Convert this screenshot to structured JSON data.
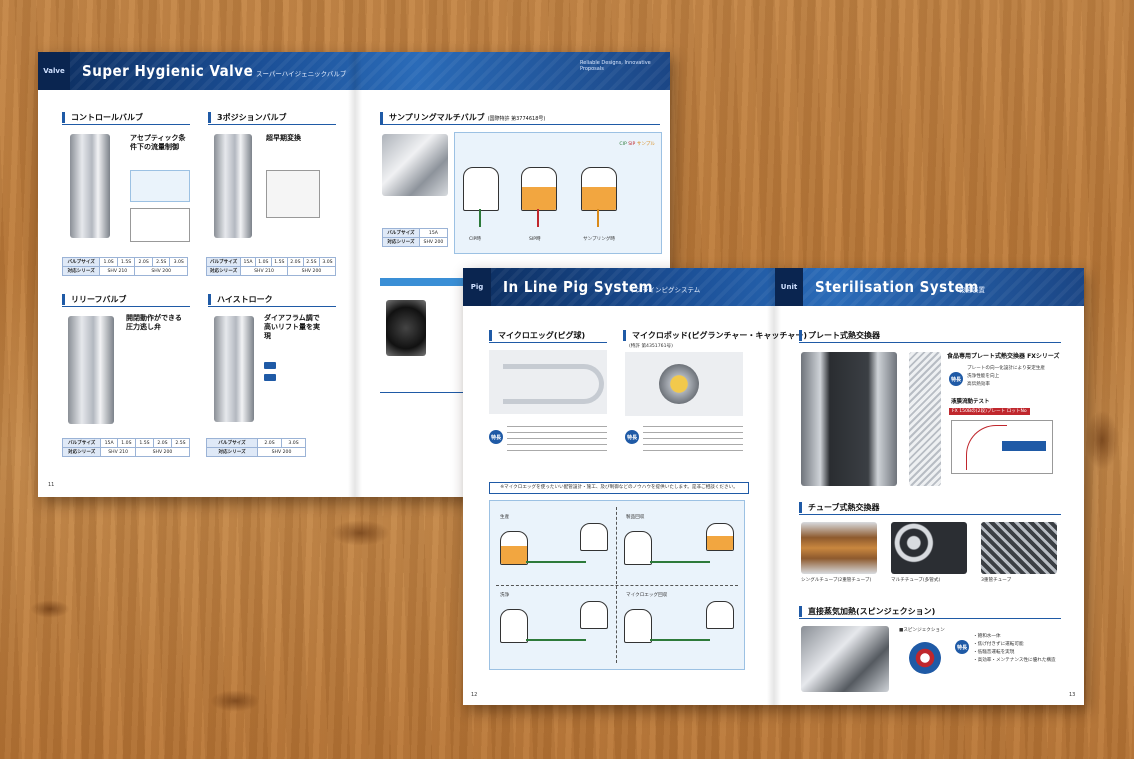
{
  "spread_left": {
    "banner_tag": "Valve",
    "banner_title": "Super Hygienic Valve",
    "banner_subtitle": "スーパーハイジェニックバルブ",
    "banner_right": "Reliable Designs, Innovative Proposals",
    "sections": {
      "control_valve": "コントロールバルブ",
      "three_position": "3ポジションバルブ",
      "sampling_multi": "サンプリングマルチバルブ",
      "sampling_patent": "(国際特許 第3774618号)",
      "relief_valve": "リリーフバルブ",
      "high_stroke": "ハイストローク"
    },
    "control_head": "アセプティック条件下の流量制御",
    "three_head": "超早期変換",
    "relief_head": "開閉動作ができる圧力逃し弁",
    "high_head": "ダイアフラム調で高いリフト量を実現",
    "table_rows": {
      "valve_size": "バルブサイズ",
      "series": "対応シリーズ"
    },
    "control_sizes": [
      "1.0S",
      "1.5S",
      "2.0S",
      "2.5S",
      "3.0S"
    ],
    "control_series": [
      "SHV 210",
      "SHV 200"
    ],
    "three_sizes": [
      "15A",
      "1.0S",
      "1.5S",
      "2.0S",
      "2.5S",
      "3.0S"
    ],
    "three_series": [
      "SHV 210",
      "SHV 200"
    ],
    "sampling_sizes": [
      "15A"
    ],
    "sampling_series": [
      "SHV 200"
    ],
    "relief_sizes": [
      "15A",
      "1.0S",
      "1.5S",
      "2.0S",
      "2.5S"
    ],
    "relief_series": [
      "SHV 210",
      "SHV 200"
    ],
    "high_sizes": [
      "2.0S",
      "3.0S"
    ],
    "high_series": [
      "SHV 200"
    ],
    "sampling_steps": [
      "CIP時",
      "SIP時",
      "サンプリング時"
    ],
    "legend": [
      "CIP",
      "SIP",
      "サンプル"
    ],
    "page_number": "11"
  },
  "spread_right": {
    "left_tag": "Pig",
    "left_title": "In Line Pig System",
    "left_subtitle": "インラインピグシステム",
    "right_tag": "Unit",
    "right_title": "Sterilisation System",
    "right_subtitle": "殺菌装置",
    "sections": {
      "micro_egg": "マイクロエッグ(ピグ球)",
      "micro_pod": "マイクロポッド(ピグランチャー・キャッチャー)",
      "micro_pod_patent": "(特許 第4351761号)",
      "plate_hx": "プレート式熱交換器",
      "tube_hx": "チューブ式熱交換器",
      "steam_injection": "直接蒸気加熱(スピンジェクション)"
    },
    "feature_badge": "特長",
    "notice": "※マイクロエッグを使ったいい配管設計・施工、及び制御などのノウハウを提供いたします。是非ご相談ください。",
    "pig_diagram_labels": [
      "生産",
      "製品回収",
      "洗浄",
      "マイクロエッグ回収"
    ],
    "plate_title": "食品専用プレート式熱交換器 FXシリーズ",
    "plate_features": [
      "プレートの向一化設計により安定生産",
      "洗浄性能を向上",
      "高伝熱効率"
    ],
    "test_label": "液膜流動テスト",
    "test_bar": "FX 150Bの(2段)プレート ロットNo",
    "tube_captions": [
      "シングルチューブ(2重管チューブ)",
      "マルチチューブ(多管式)",
      "3重管チューブ"
    ],
    "steam_caption": "■スピンジェクション",
    "steam_features": [
      "・飽和水一体",
      "・焦げ付きずに運転可能",
      "・低騒音運転を実現",
      "・高効率・メンテナンス性に優れた構造"
    ],
    "page_left": "12",
    "page_right": "13"
  }
}
